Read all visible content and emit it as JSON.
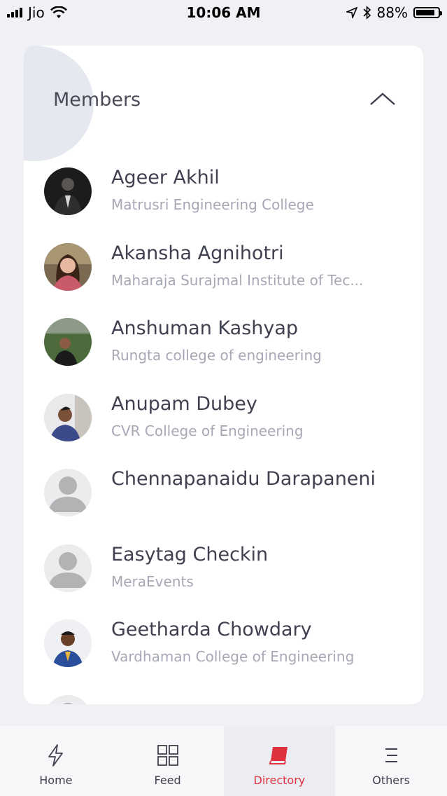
{
  "status_bar": {
    "carrier": "Jio",
    "time": "10:06 AM",
    "battery": "88%",
    "battery_level": 0.88
  },
  "members": {
    "title": "Members",
    "list": [
      {
        "name": "Ageer Akhil",
        "college": "Matrusri Engineering College"
      },
      {
        "name": "Akansha Agnihotri",
        "college": "Maharaja Surajmal Institute of Tec..."
      },
      {
        "name": "Anshuman Kashyap",
        "college": "Rungta college of engineering"
      },
      {
        "name": "Anupam Dubey",
        "college": "CVR College of Engineering"
      },
      {
        "name": "Chennapanaidu Darapaneni",
        "college": ""
      },
      {
        "name": "Easytag Checkin",
        "college": "MeraEvents"
      },
      {
        "name": "Geetharda Chowdary",
        "college": "Vardhaman College of Engineering"
      }
    ]
  },
  "tabs": [
    {
      "label": "Home",
      "icon": "lightning-icon"
    },
    {
      "label": "Feed",
      "icon": "grid-icon"
    },
    {
      "label": "Directory",
      "icon": "book-icon"
    },
    {
      "label": "Others",
      "icon": "menu-icon"
    }
  ],
  "colors": {
    "accent": "#e0313f",
    "background": "#f0f0f5"
  }
}
